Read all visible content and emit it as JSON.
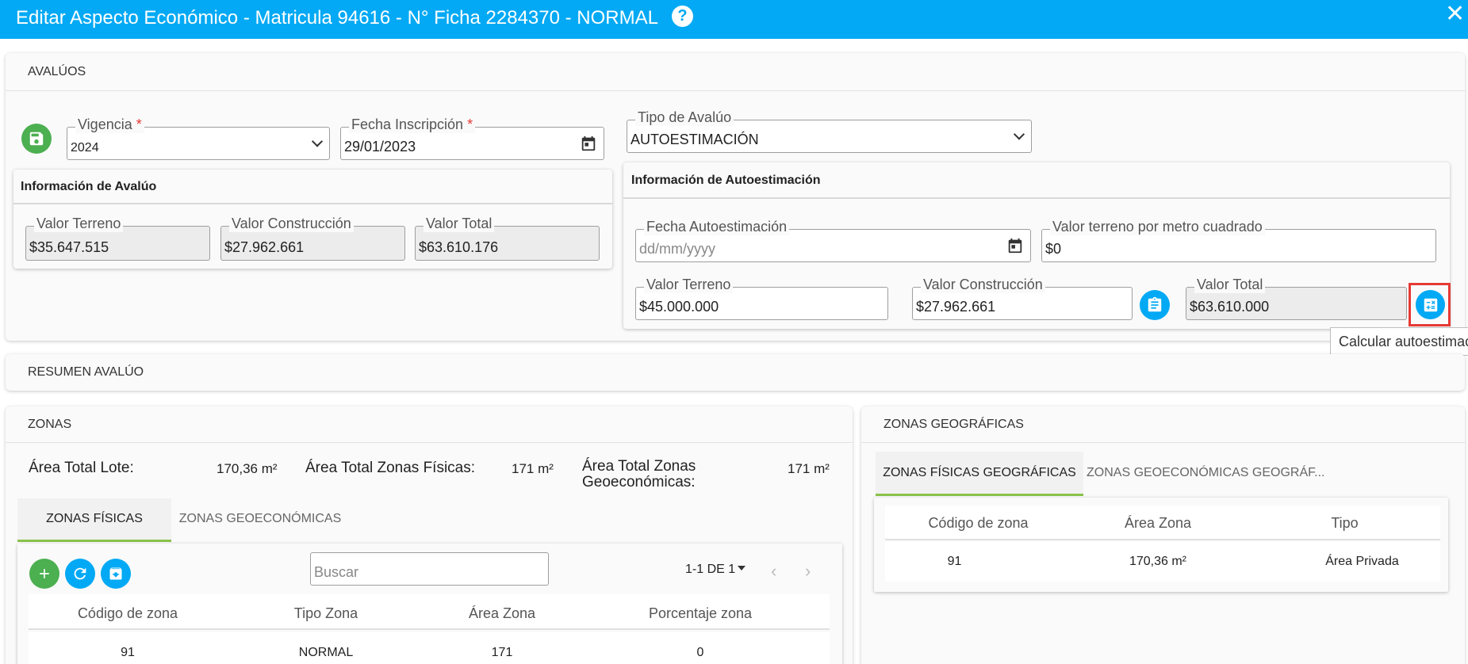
{
  "window": {
    "title": "Editar Aspecto Económico - Matricula 94616 - N° Ficha 2284370 - NORMAL",
    "help_glyph": "?",
    "close_glyph": "✕"
  },
  "avaluos": {
    "header": "AVALÚOS",
    "vigencia": {
      "label": "Vigencia",
      "required": "*",
      "value": "2024"
    },
    "fecha_inscripcion": {
      "label": "Fecha Inscripción",
      "required": "*",
      "value": "29/01/2023"
    },
    "tipo_avaluo": {
      "label": "Tipo de Avalúo",
      "value": "AUTOESTIMACIÓN"
    },
    "info_avaluo": {
      "title": "Información de Avalúo",
      "valor_terreno": {
        "label": "Valor Terreno",
        "value": "$35.647.515"
      },
      "valor_construccion": {
        "label": "Valor Construcción",
        "value": "$27.962.661"
      },
      "valor_total": {
        "label": "Valor Total",
        "value": "$63.610.176"
      }
    },
    "info_autoestimacion": {
      "title": "Información de Autoestimación",
      "fecha": {
        "label": "Fecha Autoestimación",
        "placeholder": "dd/mm/yyyy"
      },
      "valor_m2": {
        "label": "Valor terreno por metro cuadrado",
        "value": "$0"
      },
      "valor_terreno": {
        "label": "Valor Terreno",
        "value": "$45.000.000"
      },
      "valor_construccion": {
        "label": "Valor Construcción",
        "value": "$27.962.661"
      },
      "valor_total": {
        "label": "Valor Total",
        "value": "$63.610.000"
      },
      "tooltip": "Calcular autoestimación"
    }
  },
  "resumen": {
    "header": "RESUMEN AVALÚO"
  },
  "zonas": {
    "header": "ZONAS",
    "area_total_lote": {
      "label": "Área Total Lote:",
      "value": "170,36 m²"
    },
    "area_zonas_fisicas": {
      "label": "Área Total Zonas Físicas:",
      "value": "171 m²"
    },
    "area_zonas_geo": {
      "label_line1": "Área Total Zonas",
      "label_line2": "Geoeconómicas:",
      "value": "171 m²"
    },
    "tabs": [
      "ZONAS FÍSICAS",
      "ZONAS GEOECONÓMICAS"
    ],
    "search_placeholder": "Buscar",
    "pagination": "1-1 DE 1",
    "columns": [
      "Código de zona",
      "Tipo Zona",
      "Área Zona",
      "Porcentaje zona"
    ],
    "rows": [
      {
        "codigo": "91",
        "tipo": "NORMAL",
        "area": "171",
        "porcentaje": "0"
      }
    ]
  },
  "zonas_geo": {
    "header": "ZONAS GEOGRÁFICAS",
    "tabs": [
      "ZONAS FÍSICAS GEOGRÁFICAS",
      "ZONAS GEOECONÓMICAS GEOGRÁF..."
    ],
    "columns": [
      "Código de zona",
      "Área Zona",
      "Tipo"
    ],
    "rows": [
      {
        "codigo": "91",
        "area": "170,36 m²",
        "tipo": "Área Privada"
      }
    ]
  },
  "colors": {
    "primary": "#03a9f4",
    "green": "#4caf50",
    "accent_tab": "#8bc34a",
    "highlight": "#e53935"
  }
}
